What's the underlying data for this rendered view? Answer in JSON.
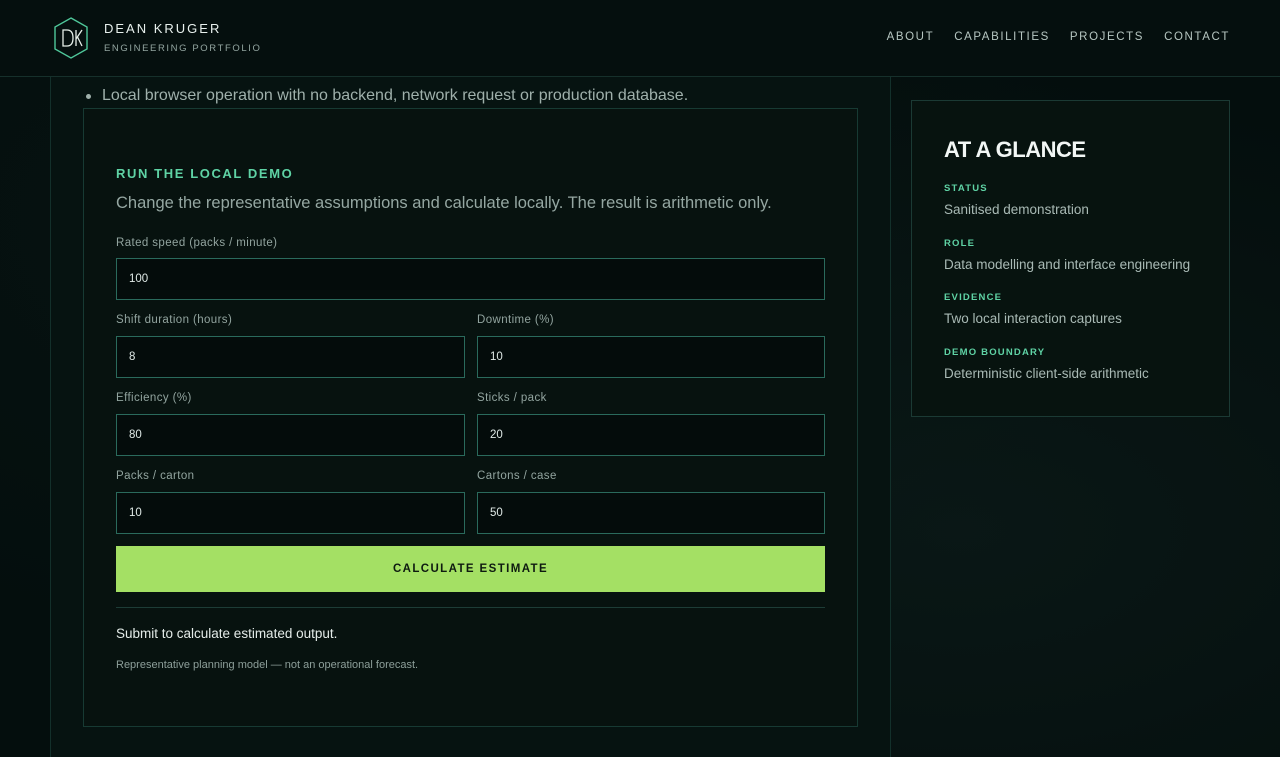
{
  "brand": {
    "name": "DEAN KRUGER",
    "subtitle": "ENGINEERING PORTFOLIO",
    "logo_icon": "dk-hexagon-logo-icon",
    "accent": "#5fd3a5"
  },
  "nav": {
    "items": [
      "ABOUT",
      "CAPABILITIES",
      "PROJECTS",
      "CONTACT"
    ]
  },
  "content": {
    "bullet": "Local browser operation with no backend, network request or production database."
  },
  "demo": {
    "eyebrow": "RUN THE LOCAL DEMO",
    "intro": "Change the representative assumptions and calculate locally. The result is arithmetic only.",
    "fields": [
      {
        "label": "Rated speed (packs / minute)",
        "value": "100"
      },
      {
        "label": "Shift duration (hours)",
        "value": "8"
      },
      {
        "label": "Downtime (%)",
        "value": "10"
      },
      {
        "label": "Efficiency (%)",
        "value": "80"
      },
      {
        "label": "Sticks / pack",
        "value": "20"
      },
      {
        "label": "Packs / carton",
        "value": "10"
      },
      {
        "label": "Cartons / case",
        "value": "50"
      }
    ],
    "button_label": "CALCULATE ESTIMATE",
    "button_color": "#a4e064",
    "result_text": "Submit to calculate estimated output.",
    "note": "Representative planning model — not an operational forecast."
  },
  "glance": {
    "title": "AT A GLANCE",
    "items": [
      {
        "label": "STATUS",
        "value": "Sanitised demonstration"
      },
      {
        "label": "ROLE",
        "value": "Data modelling and interface engineering"
      },
      {
        "label": "EVIDENCE",
        "value": "Two local interaction captures"
      },
      {
        "label": "DEMO BOUNDARY",
        "value": "Deterministic client-side arithmetic"
      }
    ]
  }
}
